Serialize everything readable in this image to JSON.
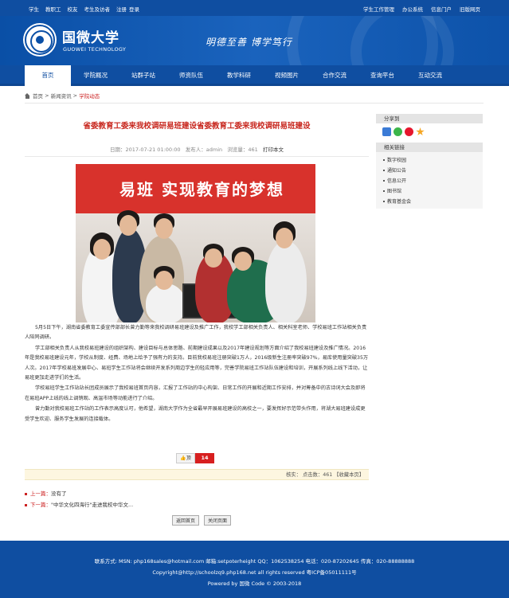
{
  "topbar": {
    "left": [
      "学生",
      "教职工",
      "校友",
      "考生及访者",
      "注册",
      "登录"
    ],
    "right": [
      "学生工作管理",
      "办公系统",
      "信息门户",
      "旧版网页"
    ]
  },
  "header": {
    "logo_cn": "国微大学",
    "logo_en": "GUOWEI TECHNOLOGY",
    "motto": "明德至善 博学笃行"
  },
  "nav": [
    "首页",
    "学院概况",
    "站群子站",
    "师资队伍",
    "教学科研",
    "视频图片",
    "合作交流",
    "查询平台",
    "互动交流"
  ],
  "breadcrumb": {
    "home": "首页",
    "news": "新闻资讯",
    "current": "学院动态"
  },
  "article": {
    "title": "省委教育工委来我校调研易班建设省委教育工委来我校调研易班建设",
    "date": "日期：2017-07-21 01:00:00",
    "publisher": "发布人：admin",
    "views": "浏览量：461",
    "print": "打印本文",
    "banner_text": "易班 实现教育的梦想",
    "paragraphs": [
      "5月5日下午，湖南省委教育工委宣传部部长曾力勤等来我校调研易班建设及推广工作，我校学工部相关负责人、相关科室老师、学校易班工作站相关负责人陪同调研。",
      "学工部相关负责人从我校易班建设的组织架构、建设目标与总体思路、前期建设成果以及2017年建设规划等方面介绍了我校易班建设及推广情况。2016年是我校易班建设元年，学校从制度、经费、场地上给予了强有力的支持。目前我校易班注册突破1万人，2016级新生注册率突破97%，易库使用量突破35万人次。2017年学校易班发展中心、易班学生工作站将会继续开发系列周边学生的轻应用等，完善学院易班工作站队伍建设和培训，开展系列线上线下活动，让易班更加走进学们的生活。",
      "学校易班学生工作站站长团成员展示了我校易班首页内容，汇报了工作站的中心构架、日常工作的开展和近期工作安排，并对筹备中的古诗词大会及即将在易班APP上线的线上调销观、高温市场等动能进行了介绍。",
      "曾力勤对我校易班工作站的工作表示高度认可，他希望，湖南大学作为全省最早开展易班建设的高校之一，要发挥好示范带头作用，将湖大易班建设成更受学生欢迎、服务学生发展的连接载体。"
    ]
  },
  "like": {
    "label": "顶",
    "count": "14"
  },
  "stats": "核实： 点击数：461 【收藏本页】",
  "prev": {
    "label": "上一篇：",
    "text": "没有了"
  },
  "next": {
    "label": "下一篇：",
    "text": "\"中华文化四海行\"走进我校中华文..."
  },
  "buttons": {
    "back": "返回首页",
    "close": "关闭页面"
  },
  "sidebar": {
    "share_title": "分享到",
    "links_title": "相关链接",
    "links": [
      "数字校园",
      "通知公告",
      "信息公开",
      "图书馆",
      "教育基金会"
    ]
  },
  "footer": {
    "line1": "联系方式: MSN: php168sales@hotmail.com 邮箱:setpoterheight QQ：1062538254 电话：020-87202645 传真：020-88888888",
    "line2": "Copyright@http://schoolzq9.php168.net all rights reserved 粤ICP备05011111号",
    "line3": "Powered by 国微 Code © 2003-2018"
  },
  "colors": {
    "brand_blue": "#0f4ea1",
    "title_red": "#c8281f",
    "banner_red": "#d8322c"
  }
}
